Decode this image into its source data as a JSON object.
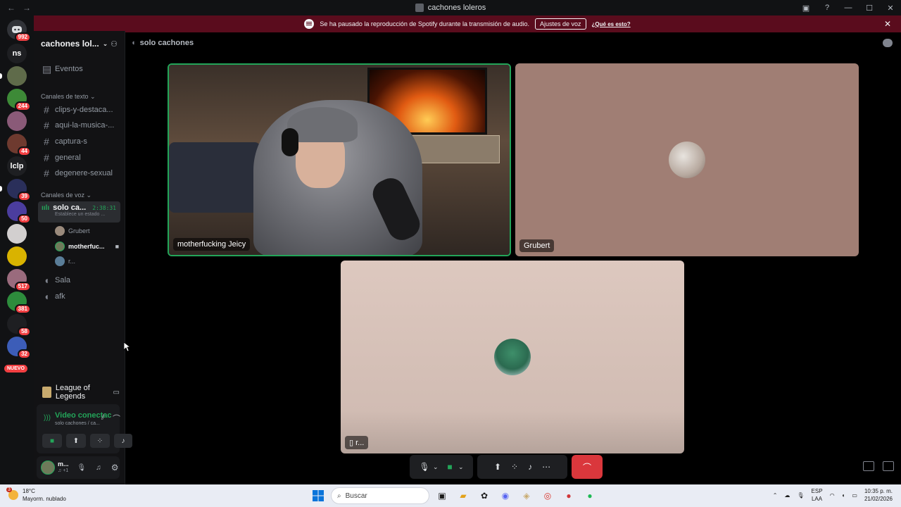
{
  "window": {
    "title": "cachones loleros",
    "back": "←",
    "forward": "→"
  },
  "notice": {
    "text": "Se ha pausado la reproducción de Spotify durante la transmisión de audio.",
    "button": "Ajustes de voz",
    "link": "¿Qué es esto?"
  },
  "rail": {
    "badges": [
      "992",
      "244",
      "44",
      "39",
      "50",
      "517",
      "381",
      "58",
      "32"
    ],
    "text_servers": [
      "ns",
      "lclp"
    ],
    "new_label": "NUEVO"
  },
  "sidebar": {
    "guild_name": "cachones lol...",
    "events": "Eventos",
    "text_category": "Canales de texto",
    "text_channels": [
      "clips-y-destaca...",
      "aqui-la-musica-...",
      "captura-s",
      "general",
      "degenere-sexual"
    ],
    "voice_category": "Canales de voz",
    "active_voice": {
      "name": "solo ca...",
      "timer": "2:38:31",
      "status": "Establece un estado ..."
    },
    "voice_users": [
      "Grubert",
      "motherfuc...",
      "r..."
    ],
    "voice_channels": [
      "Sala",
      "afk"
    ],
    "activity": "League of Legends",
    "voice_status": "Video conectac",
    "voice_sub": "solo cachones / ca...",
    "user_name": "m...",
    "user_sub": "♫ +1"
  },
  "main": {
    "channel_name": "solo cachones",
    "tiles": [
      {
        "label": "motherfucking Jeicy"
      },
      {
        "label": "Grubert"
      },
      {
        "label": "r..."
      }
    ]
  },
  "taskbar": {
    "temp": "18°C",
    "weather": "Mayorm. nublado",
    "weather_badge": "3",
    "search": "Buscar",
    "lang1": "ESP",
    "lang2": "LAA",
    "time": "10:35 p. m.",
    "date": "21/02/2026"
  },
  "colors": {
    "accent_green": "#23a559",
    "danger": "#da373c",
    "notice_bg": "#5a0c1d"
  }
}
